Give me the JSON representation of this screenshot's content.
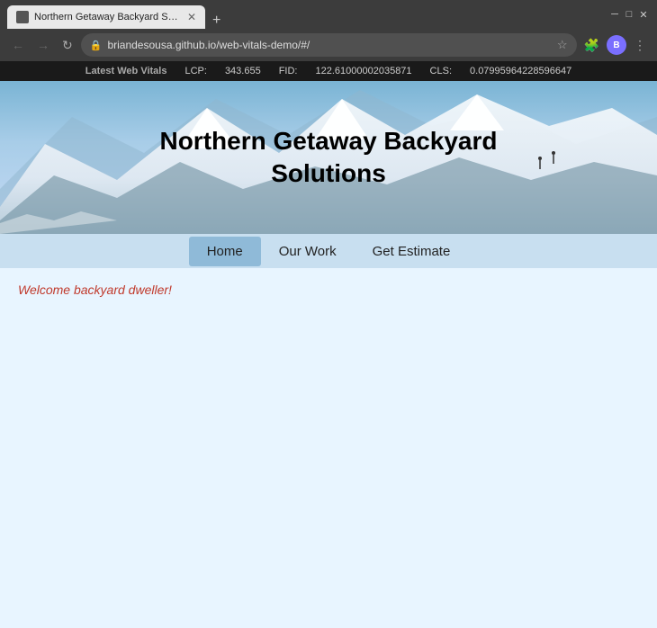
{
  "browser": {
    "tab_title": "Northern Getaway Backyard Sol...",
    "new_tab_icon": "+",
    "window_minimize": "─",
    "window_maximize": "□",
    "window_close": "✕",
    "nav_back": "←",
    "nav_forward": "→",
    "nav_reload": "↻",
    "nav_home": "⌂",
    "address_url": "briandesousa.github.io/web-vitals-demo/#/",
    "lock_symbol": "🔒",
    "star_symbol": "☆",
    "menu_icon": "⋮",
    "profile_initials": "B",
    "extensions_label": "🧩"
  },
  "vitals_bar": {
    "label": "Latest Web Vitals",
    "lcp_label": "LCP:",
    "lcp_value": "343.655",
    "fid_label": "FID:",
    "fid_value": "122.61000002035871",
    "cls_label": "CLS:",
    "cls_value": "0.07995964228596647"
  },
  "site": {
    "title_line1": "Northern Getaway Backyard",
    "title_line2": "Solutions",
    "nav": {
      "home": "Home",
      "our_work": "Our Work",
      "get_estimate": "Get Estimate"
    },
    "welcome_text": "Welcome backyard dweller!"
  }
}
